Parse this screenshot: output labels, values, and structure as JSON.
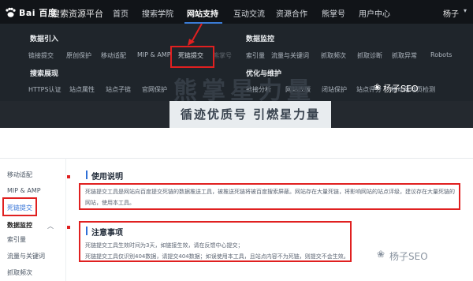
{
  "navbar": {
    "logo_text": "Bai 百度",
    "logo_sub": "搜索资源平台",
    "items": [
      "首页",
      "搜索学院",
      "网站支持",
      "互动交流",
      "资源合作",
      "熊掌号",
      "用户中心"
    ],
    "active_index": 2,
    "user": "杨子"
  },
  "menu": {
    "groups": [
      {
        "title": "数据引入",
        "links": [
          "链接提交",
          "原创保护",
          "移动适配",
          "MIP & AMP",
          "死链提交",
          "熊掌号"
        ]
      },
      {
        "title": "搜索展现",
        "links": [
          "HTTPS认证",
          "站点属性",
          "站点子链",
          "官网保护"
        ]
      },
      {
        "title": "数据监控",
        "links": [
          "索引量",
          "流量与关键词",
          "抓取频次",
          "抓取诊断",
          "抓取异常",
          "Robots"
        ]
      },
      {
        "title": "优化与维护",
        "links": [
          "链接分析",
          "网站改版",
          "闭站保护",
          "站点评分",
          "移动落地页检测"
        ]
      }
    ],
    "highlighted_link": "死链提交"
  },
  "banner": {
    "watermark": "熊掌星力量",
    "slogan": "循迹优质号 引燃星力量",
    "wechat_watermark": "杨子SEO"
  },
  "sidebar": {
    "items": [
      {
        "label": "移动适配",
        "style": "normal"
      },
      {
        "label": "MIP & AMP",
        "style": "normal"
      },
      {
        "label": "死链提交",
        "style": "selected"
      },
      {
        "label": "数据监控",
        "style": "title"
      },
      {
        "label": "索引量",
        "style": "normal"
      },
      {
        "label": "流量与关键词",
        "style": "normal"
      },
      {
        "label": "抓取频次",
        "style": "normal"
      }
    ]
  },
  "content": {
    "usage": {
      "title": "使用说明",
      "lines": [
        "死链提交工具是网站向百度提交死链的数据推送工具，被推送死链将被百度搜索屏蔽。网站存在大量死链，将影响网站的站点评级，建议存在大量死链的",
        "网站，使用本工具。"
      ]
    },
    "notes": {
      "title": "注意事项",
      "lines": [
        "死链提交工具生效时间为3天，如链接生效，请在反馈中心提交；",
        "死链提交工具仅识别404数据，请提交404数据；如误使用本工具，且站点内容不为死链，则提交不会生效。"
      ]
    },
    "wechat_watermark": "杨子SEO"
  },
  "colors": {
    "highlight": "#e02020",
    "accent": "#2f6fd6",
    "nav_bg": "#111418",
    "menu_bg": "#1f252b"
  }
}
